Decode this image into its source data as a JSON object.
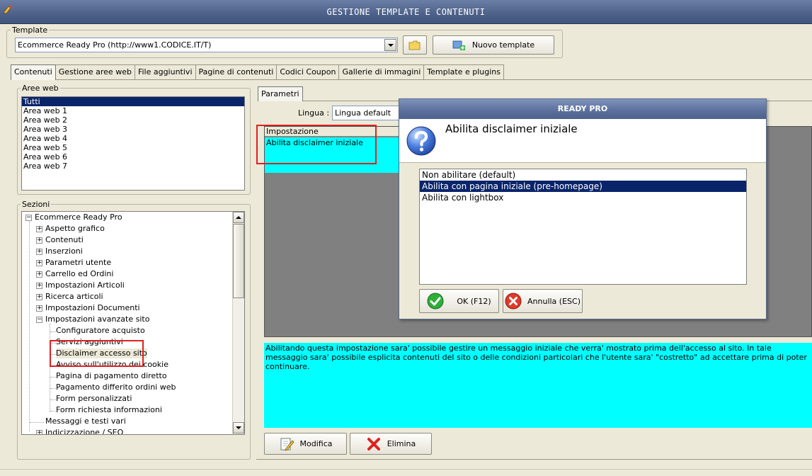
{
  "window": {
    "title": "GESTIONE TEMPLATE E CONTENUTI"
  },
  "template": {
    "group_label": "Template",
    "selected": "Ecommerce Ready Pro (http://www1.CODICE.IT/T)",
    "new_button": "Nuovo template"
  },
  "tabs": [
    {
      "label": "Contenuti",
      "active": true
    },
    {
      "label": "Gestione aree web"
    },
    {
      "label": "File aggiuntivi"
    },
    {
      "label": "Pagine di contenuti"
    },
    {
      "label": "Codici Coupon"
    },
    {
      "label": "Gallerie di immagini"
    },
    {
      "label": "Template e plugins"
    }
  ],
  "aree_web": {
    "label": "Aree web",
    "items": [
      "Tutti",
      "Area web 1",
      "Area web 2",
      "Area web 3",
      "Area web 4",
      "Area web 5",
      "Area web 6",
      "Area web 7"
    ],
    "selected_index": 0
  },
  "sezioni": {
    "label": "Sezioni",
    "root": "Ecommerce Ready Pro",
    "nodes": [
      "Aspetto grafico",
      "Contenuti",
      "Inserzioni",
      "Parametri utente",
      "Carrello ed Ordini",
      "Impostazioni Articoli",
      "Ricerca articoli",
      "Impostazioni Documenti",
      "Impostazioni avanzate sito"
    ],
    "children": [
      "Configuratore acquisto",
      "Servizi aggiuntivi",
      "Disclaimer accesso sito",
      "Avviso sull'utilizzo dei cookie",
      "Pagina di pagamento diretto",
      "Pagamento differito ordini web",
      "Form personalizzati",
      "Form richiesta informazioni"
    ],
    "after": [
      "Messaggi e testi vari",
      "Indicizzazione / SEO"
    ]
  },
  "parametri": {
    "tab_label": "Parametri",
    "lingua_label": "Lingua :",
    "lingua_value": "Lingua default",
    "column_header": "Impostazione",
    "row_value": "Abilita disclaimer iniziale",
    "description": "Abilitando questa impostazione sara' possibile gestire un messaggio iniziale che verra' mostrato prima dell'accesso al sito. In tale messaggio sara' possibile esplicita contenuti del sito o delle condizioni particolari che l'utente sara' \"costretto\" ad accettare prima di poter continuare."
  },
  "buttons": {
    "modifica": "Modifica",
    "elimina": "Elimina"
  },
  "dialog": {
    "title": "READY PRO",
    "question": "Abilita disclaimer iniziale",
    "options": [
      "Non abilitare (default)",
      "Abilita con pagina iniziale (pre-homepage)",
      "Abilita con lightbox"
    ],
    "selected_index": 1,
    "ok_label": "OK (F12)",
    "cancel_label": "Annulla (ESC)"
  },
  "colors": {
    "selection": "#0a246a",
    "cyan": "#00ffff",
    "highlight": "#e02020"
  }
}
